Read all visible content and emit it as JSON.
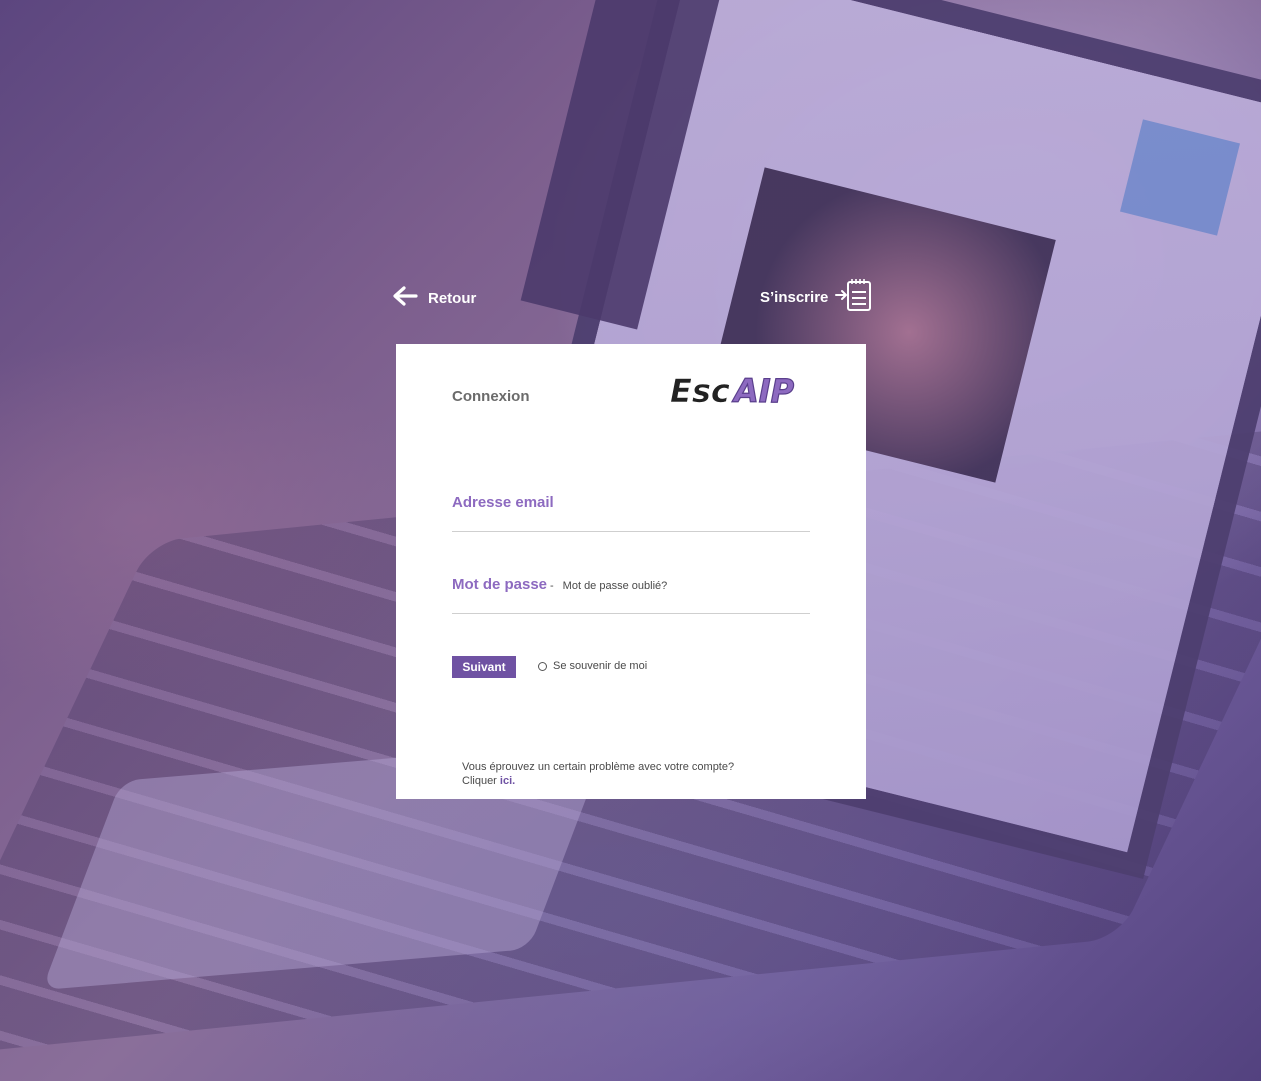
{
  "nav": {
    "back_label": "Retour",
    "signup_label": "S’inscrire"
  },
  "login": {
    "title": "Connexion",
    "logo_text": "EscAIP",
    "email_label": "Adresse email",
    "email_value": "",
    "password_label": "Mot de passe",
    "password_value": "",
    "separator": "-",
    "forgot_label": "Mot de passe oublié?",
    "submit_label": "Suivant",
    "remember_label": "Se souvenir de moi",
    "help_line1": "Vous éprouvez un certain problème avec votre compte?",
    "help_line2_prefix": "Cliquer ",
    "help_link": "ici",
    "help_suffix": "."
  },
  "colors": {
    "accent": "#6f52a3",
    "label": "#8d6ac0",
    "overlay": "#6a5792"
  },
  "icons": {
    "back": "arrow-left-icon",
    "signup": "signup-form-icon"
  }
}
